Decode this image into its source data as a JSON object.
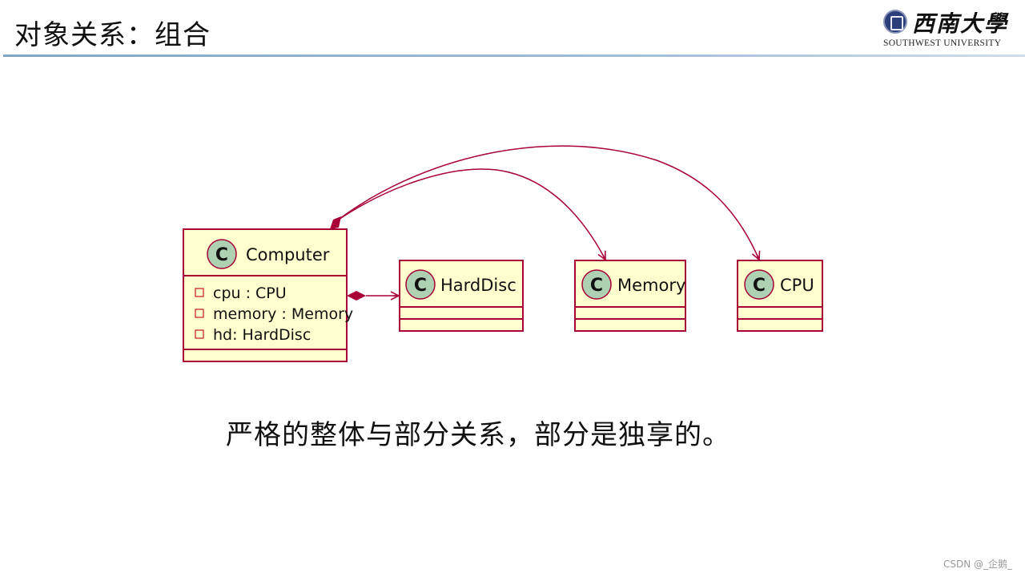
{
  "slide": {
    "title": "对象关系：组合",
    "caption": "严格的整体与部分关系，部分是独享的。",
    "watermark": "CSDN @_企鹅_"
  },
  "logo": {
    "icon": "university-emblem-icon",
    "name_cn": "西南大學",
    "name_en": "SOUTHWEST UNIVERSITY"
  },
  "colors": {
    "uml_border": "#a80036",
    "uml_fill": "#fefece",
    "class_badge": "#add1b2",
    "title_rule": "#7fa6c9"
  },
  "diagram": {
    "type": "uml-class-diagram",
    "classes": [
      {
        "id": "computer",
        "name": "Computer",
        "badge": "C",
        "attributes": [
          {
            "visibility": "private",
            "text": "cpu : CPU"
          },
          {
            "visibility": "private",
            "text": "memory : Memory"
          },
          {
            "visibility": "private",
            "text": "hd: HardDisc"
          }
        ]
      },
      {
        "id": "harddisc",
        "name": "HardDisc",
        "badge": "C",
        "attributes": []
      },
      {
        "id": "memory",
        "name": "Memory",
        "badge": "C",
        "attributes": []
      },
      {
        "id": "cpu",
        "name": "CPU",
        "badge": "C",
        "attributes": []
      }
    ],
    "relations": [
      {
        "type": "composition",
        "from": "Computer",
        "to": "HardDisc"
      },
      {
        "type": "composition",
        "from": "Computer",
        "to": "Memory"
      },
      {
        "type": "composition",
        "from": "Computer",
        "to": "CPU"
      }
    ]
  }
}
